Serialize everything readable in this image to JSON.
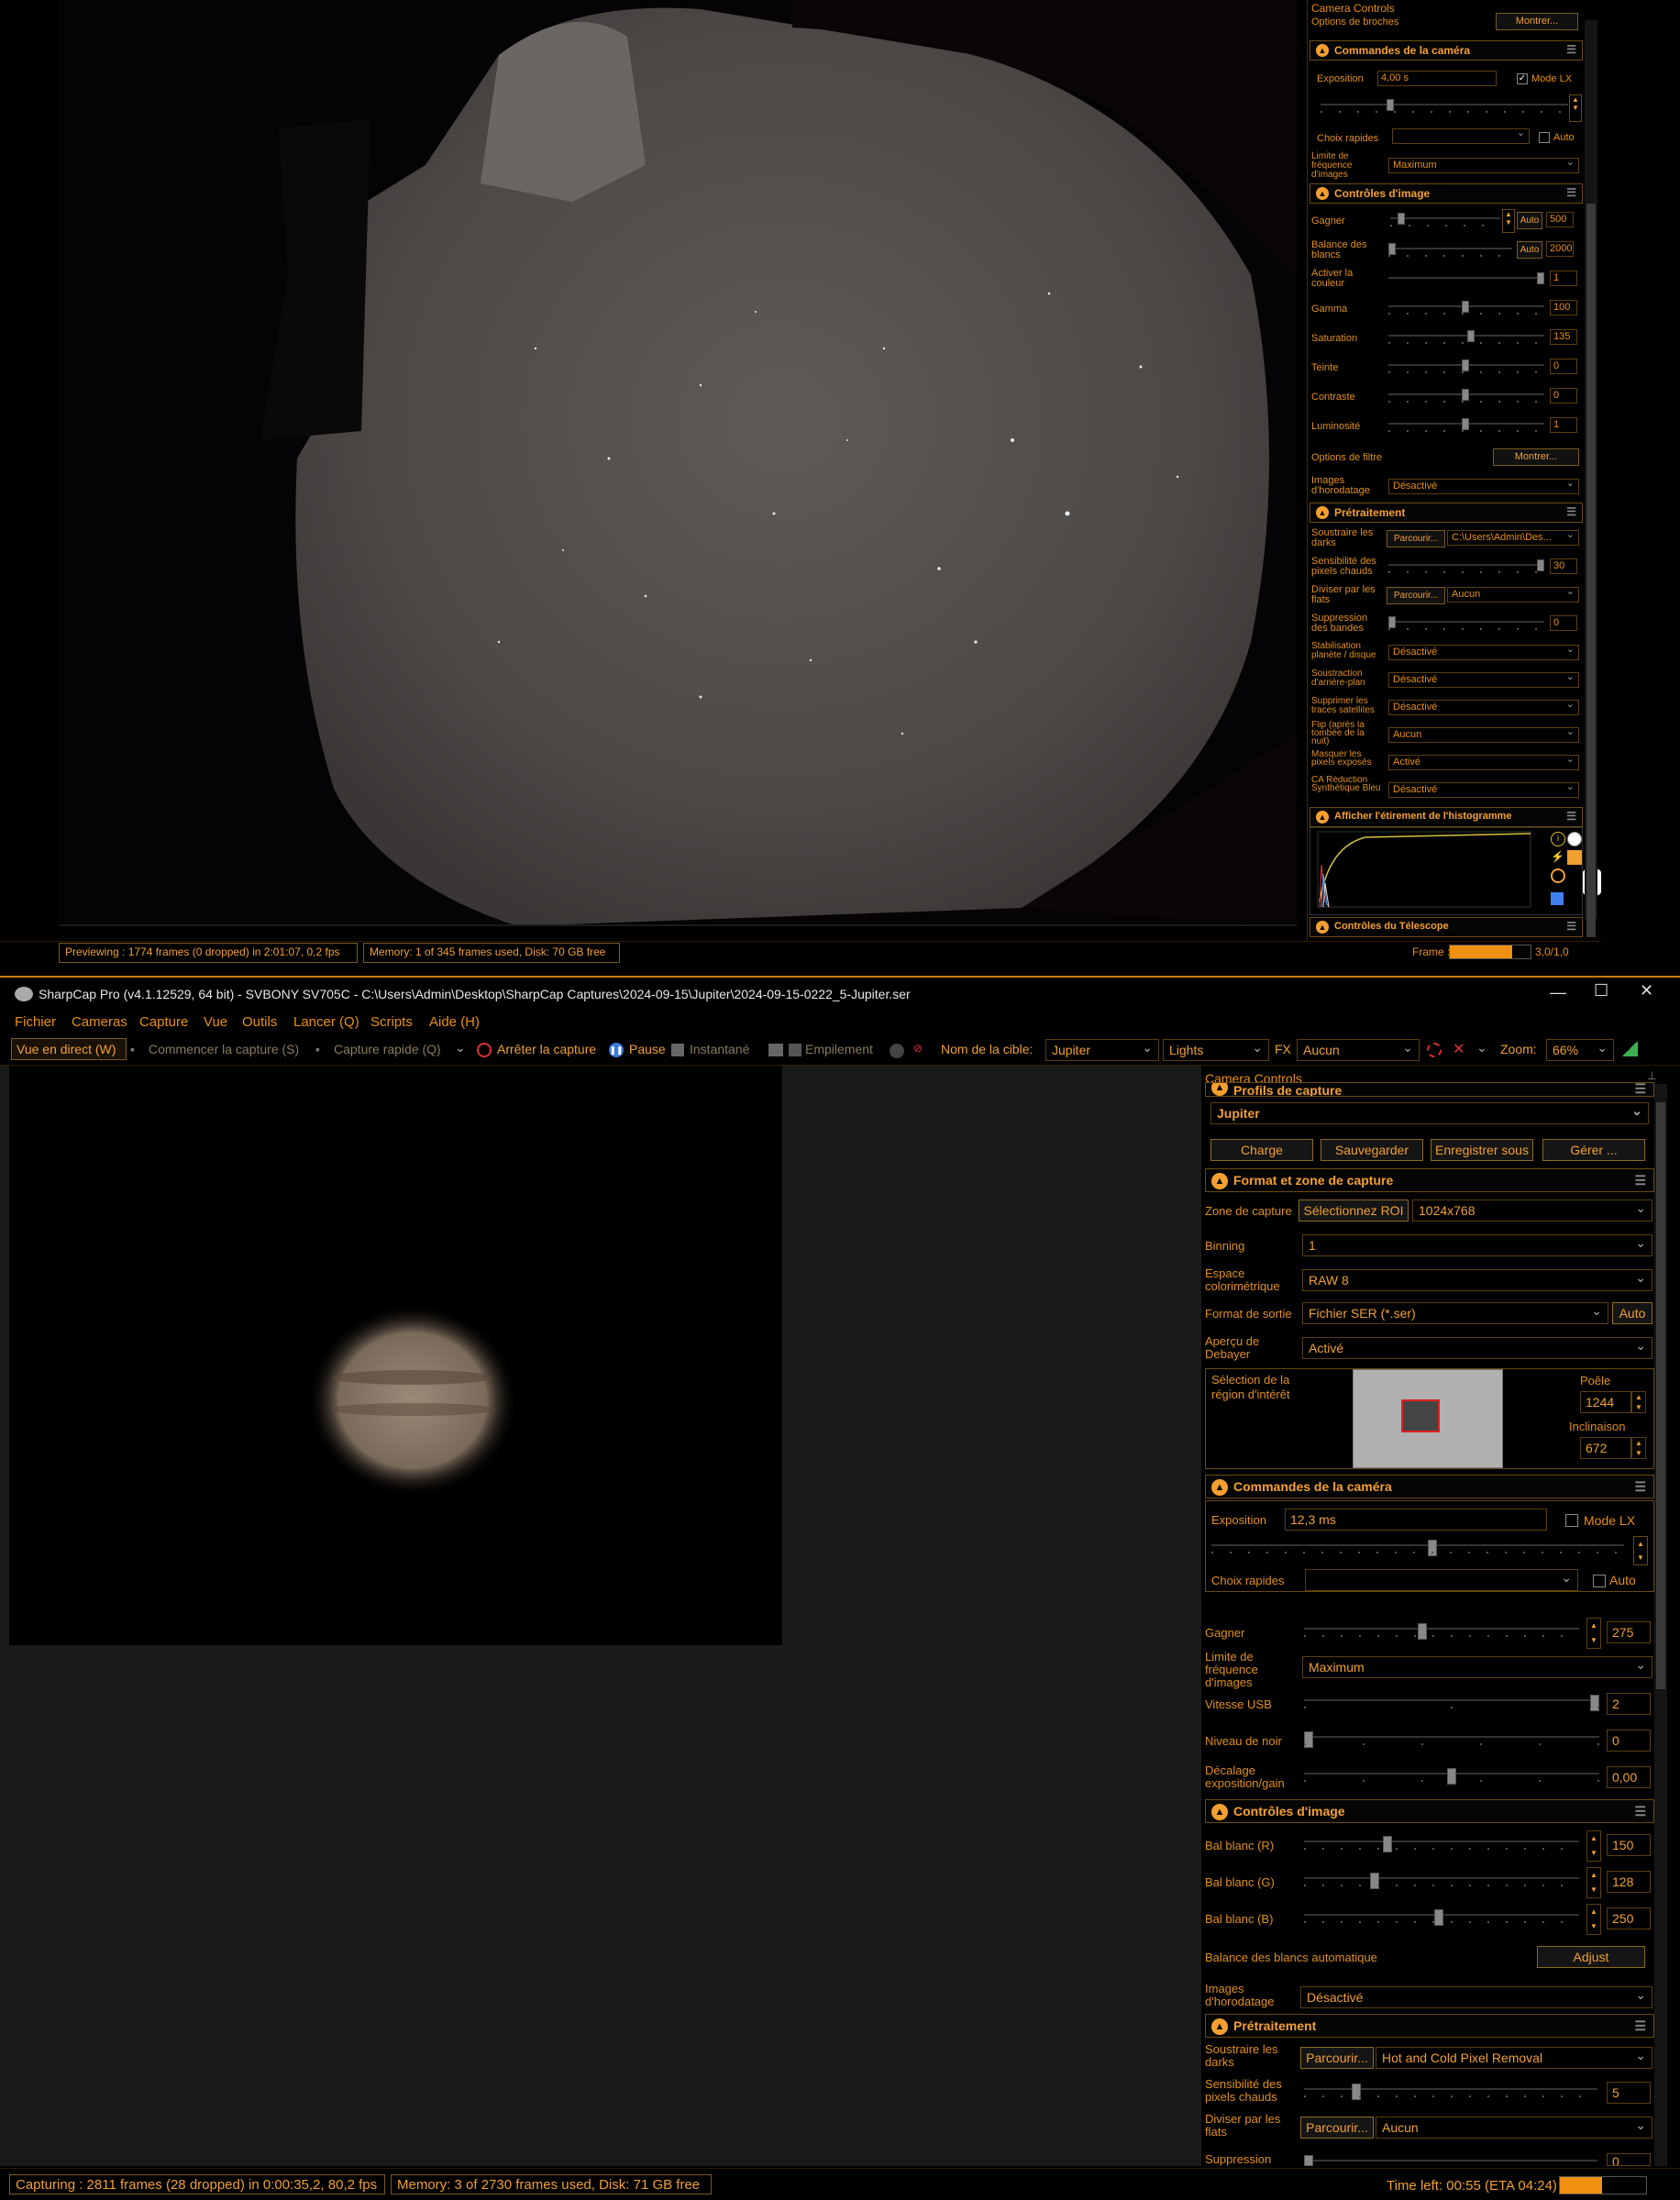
{
  "top": {
    "panel_title": "Camera Controls",
    "options_broches_label": "Options de broches",
    "options_broches_btn": "Montrer...",
    "sec_camera": "Commandes de la caméra",
    "exposition_label": "Exposition",
    "exposition_value": "4,00 s",
    "mode_lx": "Mode LX",
    "choix_rapides": "Choix rapides",
    "auto": "Auto",
    "limite_label": "Limite de fréquence d'images",
    "limite_value": "Maximum",
    "sec_image": "Contrôles d'image",
    "gagner": "Gagner",
    "gagner_val": "500",
    "balance": "Balance des blancs",
    "balance_val": "2000",
    "activer": "Activer la couleur",
    "activer_val": "1",
    "gamma": "Gamma",
    "gamma_val": "100",
    "saturation": "Saturation",
    "saturation_val": "135",
    "teinte": "Teinte",
    "teinte_val": "0",
    "contraste": "Contraste",
    "contraste_val": "0",
    "luminosite": "Luminosité",
    "luminosite_val": "1",
    "options_filtre": "Options de filtre",
    "options_filtre_btn": "Montrer...",
    "images_horo": "Images d'horodatage",
    "images_horo_val": "Désactivé",
    "sec_pretraitement": "Prétraitement",
    "soustraire": "Soustraire les darks",
    "parcourir": "Parcourir...",
    "soustraire_val": "C:\\Users\\Admin\\Des...",
    "sensibilite": "Sensibilité des pixels chauds",
    "sensibilite_val": "30",
    "diviser": "Diviser par les flats",
    "diviser_val": "Aucun",
    "suppression": "Suppression des bandes",
    "suppression_val": "0",
    "stabilisation": "Stabilisation planète / disque",
    "stabilisation_val": "Désactivé",
    "soustraction": "Soustraction d'arrière-plan",
    "soustraction_val": "Désactivé",
    "supprimer": "Supprimer les traces satellites",
    "supprimer_val": "Désactivé",
    "flip": "Flip (après la tombée de la nuit)",
    "flip_val": "Aucun",
    "masquer": "Masquer les pixels exposés",
    "masquer_val": "Activé",
    "ca": "CA Réduction Synthétique Bleu",
    "ca_val": "Désactivé",
    "sec_histo": "Afficher l'étirement de l'histogramme",
    "sec_telescope": "Contrôles du Télescope",
    "status_preview": "Previewing : 1774 frames (0 dropped) in 2:01:07, 0,2 fps",
    "status_memory": "Memory: 1 of 345 frames used, Disk: 70 GB free",
    "frame_label": "Frame :",
    "frame_val": "3,0/1,0"
  },
  "bottom": {
    "title": "SharpCap Pro (v4.1.12529, 64 bit) - SVBONY SV705C - C:\\Users\\Admin\\Desktop\\SharpCap Captures\\2024-09-15\\Jupiter\\2024-09-15-0222_5-Jupiter.ser",
    "menu": [
      "Fichier",
      "Cameras",
      "Capture",
      "Vue",
      "Outils",
      "Lancer (Q)",
      "Scripts",
      "Aide (H)"
    ],
    "tb_live": "Vue en direct (W)",
    "tb_start": "Commencer la capture (S)",
    "tb_quick": "Capture rapide (Q)",
    "tb_stop": "Arrêter la capture",
    "tb_pause": "Pause",
    "tb_snap": "Instantané",
    "tb_stack": "Empilement",
    "tb_target_label": "Nom de la cible:",
    "tb_target": "Jupiter",
    "tb_lights": "Lights",
    "tb_fx": "FX",
    "tb_fx_val": "Aucun",
    "tb_zoom": "Zoom:",
    "tb_zoom_val": "66%",
    "panel_title": "Camera Controls",
    "profils": "Profils de capture",
    "profil_val": "Jupiter",
    "charge": "Charge",
    "sauvegarder": "Sauvegarder",
    "enregistrer": "Enregistrer sous",
    "gerer": "Gérer ...",
    "sec_format": "Format et zone de capture",
    "zone": "Zone de capture",
    "zone_btn": "Sélectionnez ROI",
    "zone_val": "1024x768",
    "binning": "Binning",
    "binning_val": "1",
    "espace": "Espace colorimétrique",
    "espace_val": "RAW 8",
    "format": "Format de sortie",
    "format_val": "Fichier SER (*.ser)",
    "format_auto": "Auto",
    "apercu": "Aperçu de Debayer",
    "apercu_val": "Activé",
    "roi_label": "Sélection de la région d'intérêt",
    "poele": "Poêle",
    "poele_val": "1244",
    "inclinaison": "Inclinaison",
    "inclinaison_val": "672",
    "sec_camera": "Commandes de la caméra",
    "exposition": "Exposition",
    "exposition_val": "12,3 ms",
    "mode_lx": "Mode LX",
    "choix": "Choix rapides",
    "auto": "Auto",
    "gagner": "Gagner",
    "gagner_val": "275",
    "limite": "Limite de fréquence d'images",
    "limite_val": "Maximum",
    "usb": "Vitesse USB",
    "usb_val": "2",
    "noir": "Niveau de noir",
    "noir_val": "0",
    "decalage": "Décalage exposition/gain",
    "decalage_val": "0,00",
    "sec_image": "Contrôles d'image",
    "balr": "Bal blanc (R)",
    "balr_val": "150",
    "balg": "Bal blanc (G)",
    "balg_val": "128",
    "balb": "Bal blanc (B)",
    "balb_val": "250",
    "balauto": "Balance des blancs automatique",
    "adjust": "Adjust",
    "horo": "Images d'horodatage",
    "horo_val": "Désactivé",
    "sec_pre": "Prétraitement",
    "soustraire": "Soustraire les darks",
    "parcourir": "Parcourir...",
    "soustraire_val": "Hot and Cold Pixel Removal",
    "sensibilite": "Sensibilité des pixels chauds",
    "sensibilite_val": "5",
    "diviser": "Diviser par les flats",
    "diviser_val": "Aucun",
    "suppression": "Suppression",
    "suppression_val": "0",
    "status_capture": "Capturing : 2811 frames (28 dropped) in 0:00:35,2, 80,2 fps",
    "status_memory": "Memory: 3 of 2730 frames used, Disk: 71 GB free",
    "time_left": "Time left: 00:55 (ETA 04:24)"
  }
}
